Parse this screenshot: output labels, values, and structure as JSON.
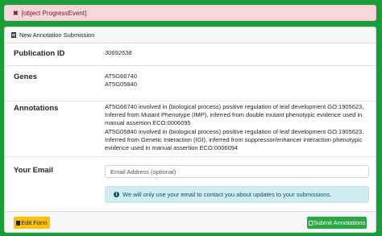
{
  "alert": {
    "icon": "close-icon",
    "message": "[object ProgressEvent]"
  },
  "card": {
    "title": "New Annotation Submission",
    "icon": "document-icon"
  },
  "publication": {
    "label": "Publication ID",
    "value": "30692538"
  },
  "genes": {
    "label": "Genes",
    "list": [
      "AT5G66740",
      "AT5G05840"
    ]
  },
  "annotations": {
    "label": "Annotations",
    "items": [
      "AT5G66740 involved in (biological process) positive regulation of leaf development GO:1905623, Inferred from Mutant Phenotype (IMP), inferred from double mutant phenotypic evidence used in manual assertion ECO:0006095",
      "AT5G05840 involved in (biological process) positive regulation of leaf development GO:1905623, Inferred from Genetic Interaction (IGI), inferred from suppressor/enhancer interaction phenotypic evidence used in manual assertion ECO:0006094"
    ]
  },
  "email": {
    "label": "Your Email",
    "placeholder": "Email Address (optional)",
    "value": "",
    "info": "We will only use your email to contact you about updates to your submissions."
  },
  "actions": {
    "edit_label": "Edit Form",
    "submit_label": "Submit Annotations"
  },
  "colors": {
    "page_bg": "#1a9c3a",
    "alert_bg": "#f8d7da",
    "info_bg": "#d1ecf1",
    "edit_btn": "#ffc107",
    "submit_btn": "#28a745"
  }
}
